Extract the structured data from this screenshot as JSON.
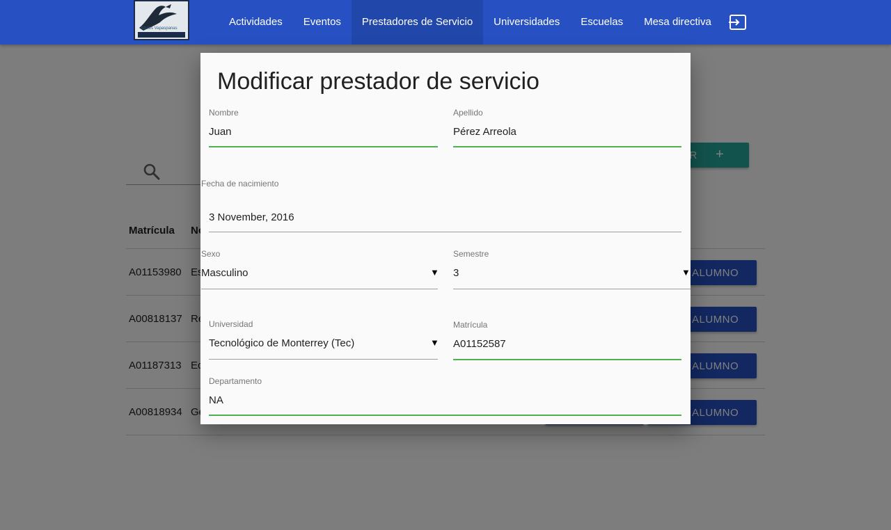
{
  "navbar": {
    "logo_text": "Azules Vapaspanas",
    "items": [
      {
        "label": "Actividades",
        "active": false
      },
      {
        "label": "Eventos",
        "active": false
      },
      {
        "label": "Prestadores de Servicio",
        "active": true
      },
      {
        "label": "Universidades",
        "active": false
      },
      {
        "label": "Escuelas",
        "active": false
      },
      {
        "label": "Mesa directiva",
        "active": false
      }
    ],
    "logout_icon": "logout-icon"
  },
  "page": {
    "search_icon": "search-icon",
    "add_button_text": "AR",
    "add_button_icon": "+",
    "table": {
      "headers": [
        "Matrícula",
        "No"
      ],
      "rows": [
        {
          "matricula": "A01153980",
          "name": "Es",
          "button": "ALUMNO"
        },
        {
          "matricula": "A00818137",
          "name": "Re",
          "button": "ALUMNO"
        },
        {
          "matricula": "A01187313",
          "name": "Ec",
          "button": "ALUMNO"
        },
        {
          "matricula": "A00818934",
          "name": "Ge",
          "button": "ALUMNO"
        }
      ]
    }
  },
  "modal": {
    "title": "Modificar prestador de servicio",
    "nombre": {
      "label": "Nombre",
      "value": "Juan"
    },
    "apellido": {
      "label": "Apellido",
      "value": "Pérez Arreola"
    },
    "fecha": {
      "label": "Fecha de nacimiento",
      "value": "3 November, 2016"
    },
    "sexo": {
      "label": "Sexo",
      "value": "Masculino"
    },
    "semestre": {
      "label": "Semestre",
      "value": "3"
    },
    "universidad": {
      "label": "Universidad",
      "value": "Tecnológico de Monterrey (Tec)"
    },
    "matricula": {
      "label": "Matrícula",
      "value": "A01152587"
    },
    "departamento": {
      "label": "Departamento",
      "value": "NA"
    },
    "dropdown_caret": "▼"
  },
  "colors": {
    "navbar": "#2751c3",
    "add_button": "#26a69a",
    "row_button": "#2751c3",
    "valid_underline": "#4caf50"
  }
}
